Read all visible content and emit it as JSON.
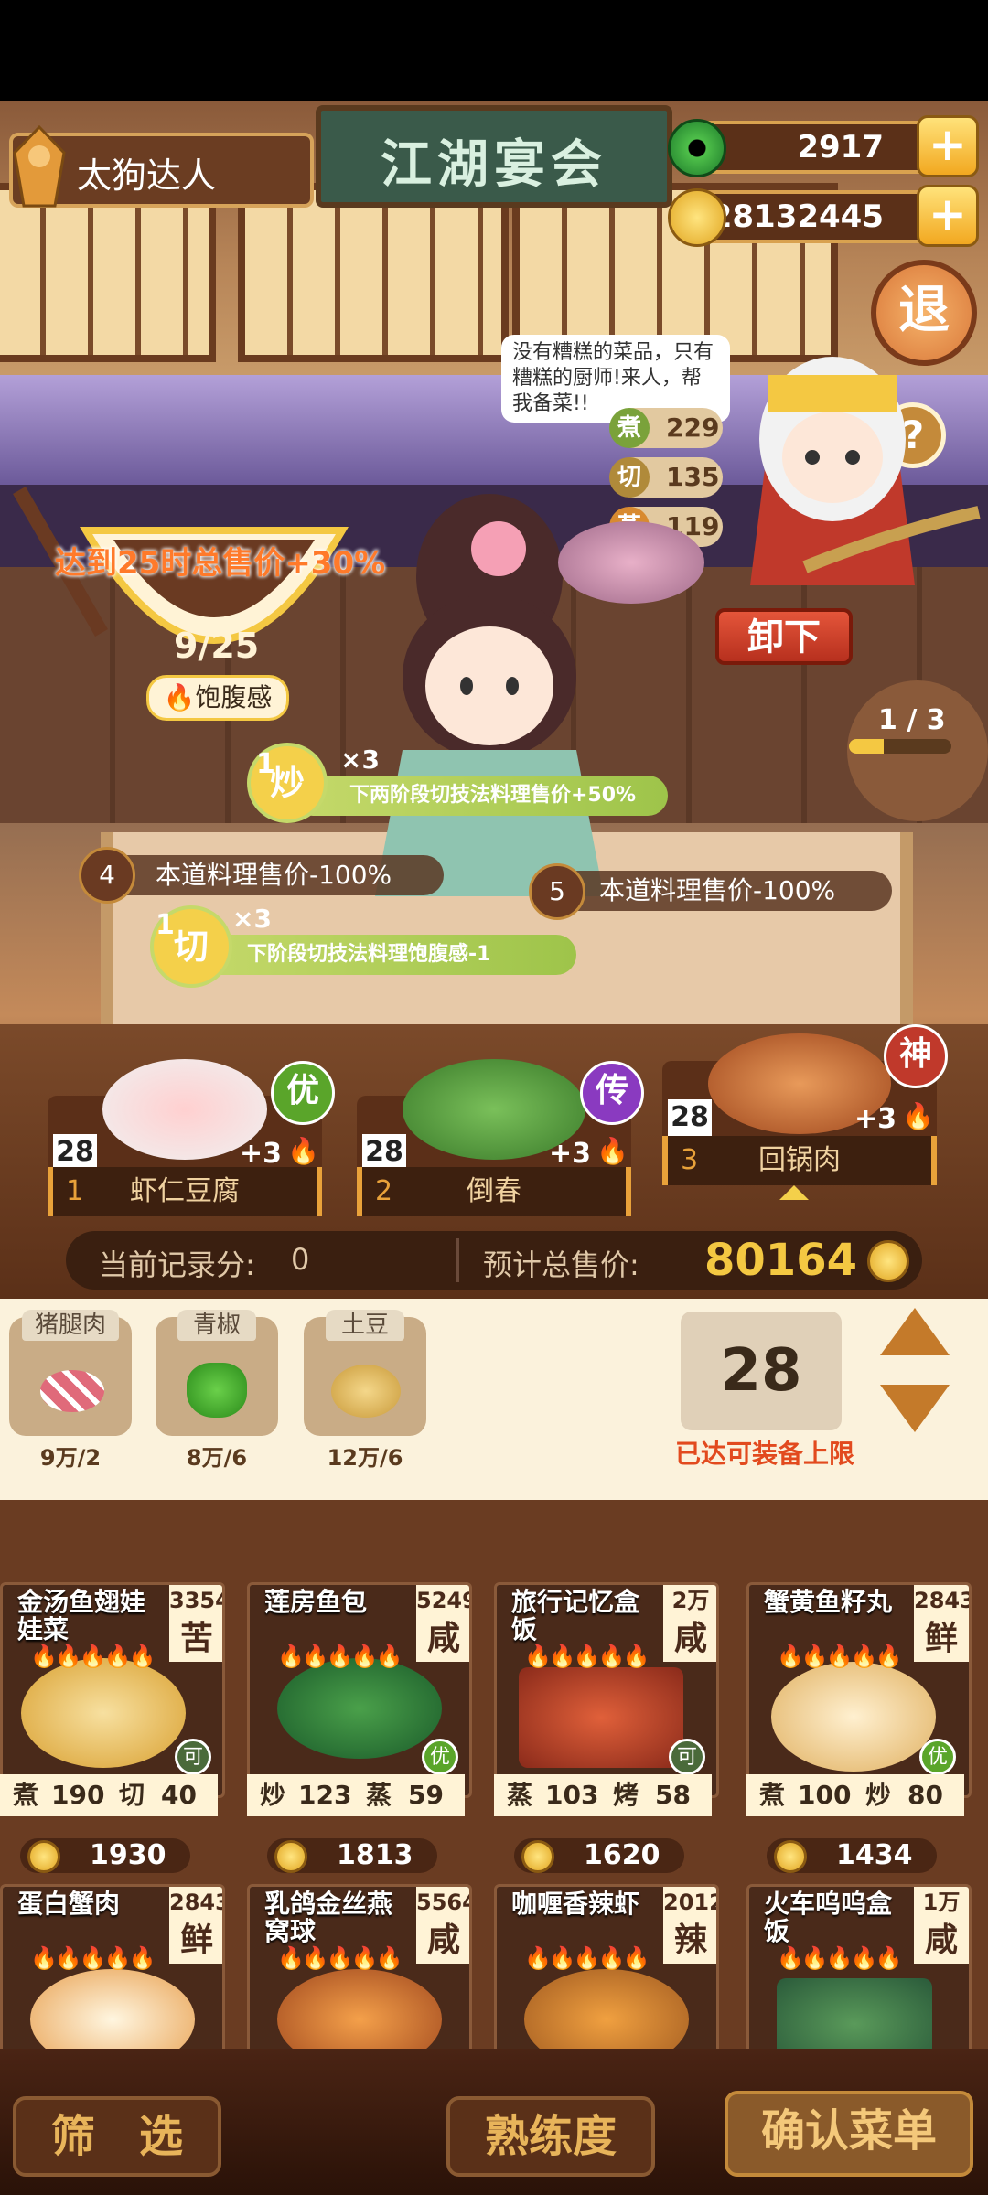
{
  "header": {
    "player_name": "太狗达人",
    "sign_title": "江湖宴会",
    "jade_amount": "2917",
    "coin_amount": "28132445",
    "exit_label": "退",
    "help_label": "?"
  },
  "chef": {
    "speech": "没有糟糕的菜品，只有糟糕的厨师!来人，帮我备菜!!",
    "stats": [
      {
        "skill": "煮",
        "value": "229",
        "color": "#7aa23a"
      },
      {
        "skill": "切",
        "value": "135",
        "color": "#b08a3a"
      },
      {
        "skill": "蒸",
        "value": "119",
        "color": "#d88a30"
      }
    ],
    "unload_label": "卸下",
    "progress": "1 / 3"
  },
  "satiety": {
    "bonus_text": "达到25时总售价+30%",
    "current": "9/25",
    "current_value": 9,
    "max_value": 25,
    "label": "饱腹感"
  },
  "effects": [
    {
      "step": "1",
      "skill": "炒",
      "mult": "×3",
      "text": "下两阶段切技法料理售价+50%",
      "kind": "buff"
    },
    {
      "step": "4",
      "text": "本道料理售价-100%",
      "kind": "debuff"
    },
    {
      "step": "5",
      "text": "本道料理售价-100%",
      "kind": "debuff"
    },
    {
      "step": "1",
      "skill": "切",
      "mult": "×3",
      "text": "下阶段切技法料理饱腹感-1",
      "kind": "buff"
    }
  ],
  "dish_slots": [
    {
      "index": "1",
      "name": "虾仁豆腐",
      "level": "28",
      "grade": "优",
      "grade_color": "#5aa52a",
      "bonus": "+3"
    },
    {
      "index": "2",
      "name": "倒春",
      "level": "28",
      "grade": "传",
      "grade_color": "#8a3ac0",
      "bonus": "+3"
    },
    {
      "index": "3",
      "name": "回锅肉",
      "level": "28",
      "grade": "神",
      "grade_color": "#c0392b",
      "bonus": "+3"
    }
  ],
  "score": {
    "record_label": "当前记录分:",
    "record_value": "0",
    "total_label": "预计总售价:",
    "total_value": "80164"
  },
  "ingredients": [
    {
      "name": "猪腿肉",
      "count": "9万/2",
      "icon": "pork-icon"
    },
    {
      "name": "青椒",
      "count": "8万/6",
      "icon": "green-pepper-icon"
    },
    {
      "name": "土豆",
      "count": "12万/6",
      "icon": "potato-icon"
    }
  ],
  "level_selector": {
    "value": "28",
    "note": "已达可装备上限"
  },
  "recipes": [
    {
      "name": "金汤鱼翅娃娃菜",
      "price": "3354",
      "taste": "苦",
      "skill1": "煮",
      "v1": "190",
      "skill2": "切",
      "v2": "40",
      "sell": "1930",
      "tag": "可"
    },
    {
      "name": "莲房鱼包",
      "price": "5249",
      "taste": "咸",
      "skill1": "炒",
      "v1": "123",
      "skill2": "蒸",
      "v2": "59",
      "sell": "1813",
      "tag": "优"
    },
    {
      "name": "旅行记忆盒饭",
      "price": "2万",
      "taste": "咸",
      "skill1": "蒸",
      "v1": "103",
      "skill2": "烤",
      "v2": "58",
      "sell": "1620",
      "tag": "可"
    },
    {
      "name": "蟹黄鱼籽丸",
      "price": "2843",
      "taste": "鲜",
      "skill1": "煮",
      "v1": "100",
      "skill2": "炒",
      "v2": "80",
      "sell": "1434",
      "tag": "优"
    },
    {
      "name": "蛋白蟹肉",
      "price": "2843",
      "taste": "鲜"
    },
    {
      "name": "乳鸽金丝燕窝球",
      "price": "5564",
      "taste": "咸"
    },
    {
      "name": "咖喱香辣虾",
      "price": "2012",
      "taste": "辣"
    },
    {
      "name": "火车呜呜盒饭",
      "price": "1万",
      "taste": "咸"
    }
  ],
  "bottom": {
    "filter": "筛　选",
    "proficiency": "熟练度",
    "confirm": "确认菜单"
  }
}
